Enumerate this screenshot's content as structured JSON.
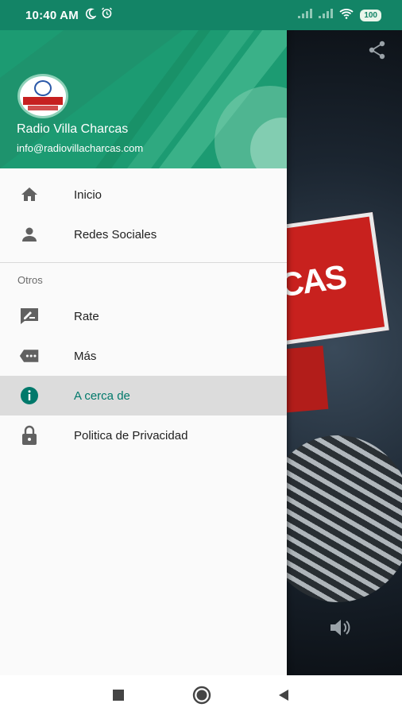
{
  "status_bar": {
    "time": "10:40 AM",
    "battery": "100"
  },
  "drawer": {
    "header": {
      "app_name": "Radio Villa Charcas",
      "email": "info@radiovillacharcas.com"
    },
    "primary_items": [
      {
        "label": "Inicio",
        "icon": "home-icon"
      },
      {
        "label": "Redes Sociales",
        "icon": "person-icon"
      }
    ],
    "section_label": "Otros",
    "secondary_items": [
      {
        "label": "Rate",
        "icon": "rate-review-icon"
      },
      {
        "label": "Más",
        "icon": "more-icon"
      },
      {
        "label": "A cerca de",
        "icon": "info-icon",
        "active": true
      },
      {
        "label": "Politica de Privacidad",
        "icon": "lock-icon"
      }
    ]
  },
  "background": {
    "banner_text": "CAS"
  },
  "colors": {
    "status_bar": "#138466",
    "header": "#1c9b72",
    "active_text": "#00796b",
    "active_bg": "#dcdcdc"
  }
}
